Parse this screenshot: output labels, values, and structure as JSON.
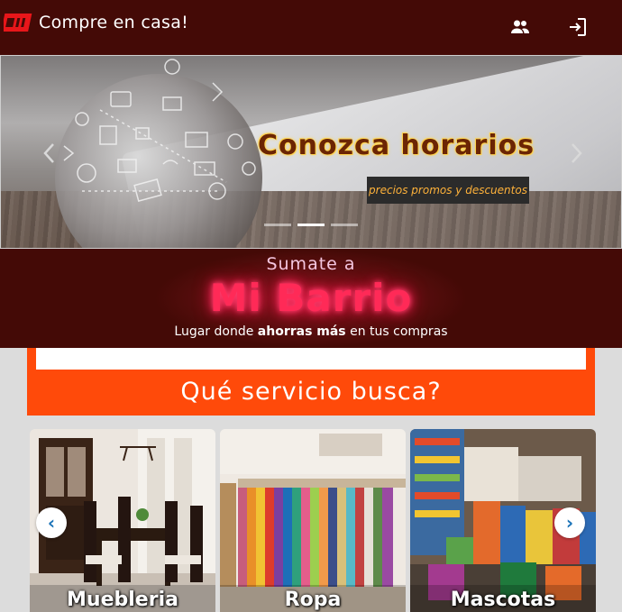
{
  "header": {
    "app_title": "Compre en casa!",
    "icons": [
      "logo-icon",
      "users-icon",
      "login-icon"
    ],
    "bg_color": "#440a06"
  },
  "hero_carousel": {
    "headline": "Conozca horarios",
    "tagline": "precios promos y descuentos",
    "indicator_count": 3,
    "active_indicator": 2
  },
  "promo": {
    "subtitle": "Sumate a",
    "title": "Mi Barrio",
    "tagline_pre": "Lugar donde ",
    "tagline_bold": "ahorras más",
    "tagline_post": " en tus compras",
    "accent_color": "#ff2a57"
  },
  "services": {
    "heading": "Qué servicio busca?",
    "accent_color": "#ff4a0a",
    "categories": [
      {
        "label": "Muebleria"
      },
      {
        "label": "Ropa"
      },
      {
        "label": "Mascotas"
      }
    ],
    "prev_glyph": "‹",
    "next_glyph": "›"
  }
}
